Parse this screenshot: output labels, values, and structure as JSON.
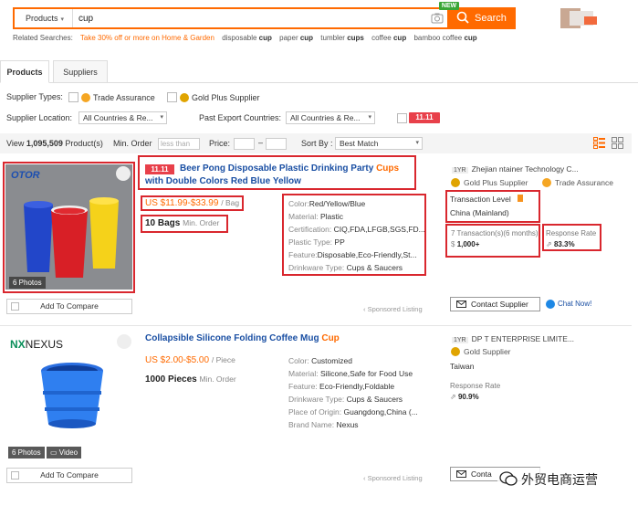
{
  "search": {
    "scope": "Products",
    "query": "cup",
    "button_label": "Search",
    "new_badge": "NEW"
  },
  "related": {
    "label": "Related Searches:",
    "promo": "Take 30% off or more on Home & Garden",
    "terms": [
      {
        "pre": "disposable ",
        "b": "cup"
      },
      {
        "pre": "paper ",
        "b": "cup"
      },
      {
        "pre": "tumbler ",
        "b": "cups"
      },
      {
        "pre": "coffee ",
        "b": "cup"
      },
      {
        "pre": "bamboo coffee ",
        "b": "cup"
      }
    ]
  },
  "tabs": [
    "Products",
    "Suppliers"
  ],
  "filters": {
    "supplier_types_label": "Supplier Types:",
    "trade_assurance": "Trade Assurance",
    "gold_plus": "Gold Plus Supplier",
    "supplier_location_label": "Supplier Location:",
    "location_value": "All Countries & Re...",
    "past_export_label": "Past Export Countries:",
    "export_value": "All Countries & Re...",
    "promo_tag": "11.11"
  },
  "view": {
    "count_prefix": "View ",
    "count": "1,095,509",
    "count_suffix": " Product(s)",
    "min_order_label": "Min. Order",
    "min_order_placeholder": "less than",
    "price_label": "Price:",
    "price_sep": "–",
    "sort_label": "Sort By :",
    "sort_value": "Best Match"
  },
  "products": [
    {
      "brand_logo": "OTOR",
      "photos": "6 Photos",
      "tag": "11.11",
      "title_pre": "Beer Pong Disposable Plastic Drinking Party ",
      "title_hl": "Cups",
      "title_post": " with Double Colors Red Blue Yellow",
      "price": "US $11.99-$33.99",
      "price_unit": "/ Bag",
      "moq": "10 Bags",
      "moq_unit": "Min. Order",
      "attrs": [
        {
          "k": "Color:",
          "v": "Red/Yellow/Blue"
        },
        {
          "k": "Material:",
          "v": "Plastic"
        },
        {
          "k": "Certification:",
          "v": "CIQ,FDA,LFGB,SGS,FD..."
        },
        {
          "k": "Plastic Type:",
          "v": "PP"
        },
        {
          "k": "Feature:",
          "v": "Disposable,Eco-Friendly,St..."
        },
        {
          "k": "Drinkware Type:",
          "v": "Cups & Saucers"
        }
      ],
      "compare": "Add To Compare",
      "sponsored": "Sponsored Listing",
      "supplier": {
        "years": "1YR",
        "name": "Zhejian        ntainer Technology C...",
        "gold": "Gold Plus Supplier",
        "trade": "Trade Assurance",
        "tx_level_label": "Transaction Level",
        "country": "China (Mainland)",
        "tx_count": "7 Transaction(s)(6 months)",
        "tx_amount": "1,000+",
        "rr_label": "Response Rate",
        "rr_value": "83.3%",
        "contact": "Contact Supplier",
        "chat": "Chat Now!"
      }
    },
    {
      "brand_logo": "NEXUS",
      "photos": "6 Photos",
      "video": "Video",
      "title_pre": "Collapsible Silicone Folding Coffee Mug ",
      "title_hl": "Cup",
      "title_post": "",
      "price": "US $2.00-$5.00",
      "price_unit": "/ Piece",
      "moq": "1000 Pieces",
      "moq_unit": "Min. Order",
      "attrs": [
        {
          "k": "Color:",
          "v": "Customized"
        },
        {
          "k": "Material:",
          "v": "Silicone,Safe for Food Use"
        },
        {
          "k": "Feature:",
          "v": "Eco-Friendly,Foldable"
        },
        {
          "k": "Drinkware Type:",
          "v": "Cups & Saucers"
        },
        {
          "k": "Place of Origin:",
          "v": "Guangdong,China (..."
        },
        {
          "k": "Brand Name:",
          "v": "Nexus"
        }
      ],
      "compare": "Add To Compare",
      "sponsored": "Sponsored Listing",
      "supplier": {
        "years": "1YR",
        "name": "DP              T ENTERPRISE LIMITE...",
        "gold": "Gold Supplier",
        "country": "Taiwan",
        "rr_label": "Response Rate",
        "rr_value": "90.9%",
        "contact": "Conta"
      }
    }
  ],
  "watermark": "外贸电商运营"
}
